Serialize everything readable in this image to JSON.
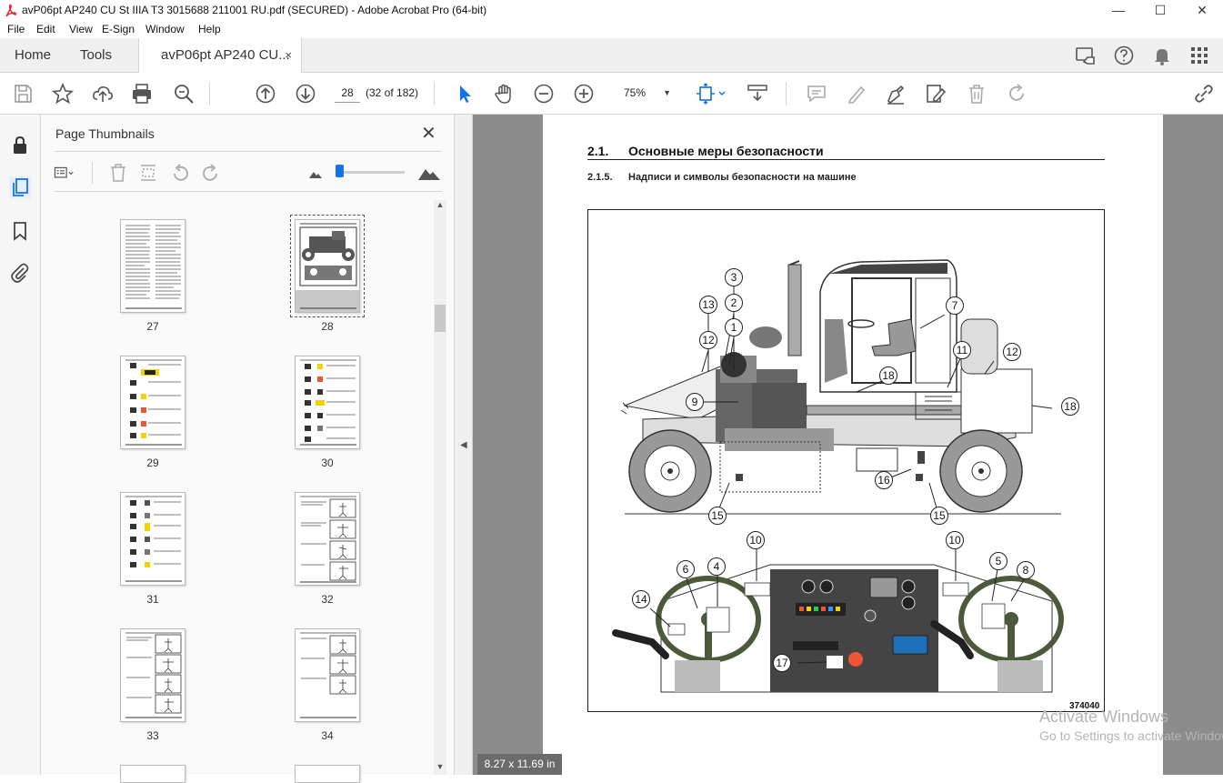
{
  "window": {
    "title": "avP06pt AP240 CU St IIIA T3 3015688 211001 RU.pdf (SECURED) - Adobe Acrobat Pro (64-bit)",
    "minimize": "—",
    "maximize": "☐",
    "close": "✕"
  },
  "menu": [
    "File",
    "Edit",
    "View",
    "E-Sign",
    "Window",
    "Help"
  ],
  "tabs": {
    "home": "Home",
    "tools": "Tools",
    "document": "avP06pt AP240 CU...",
    "close": "×"
  },
  "toolbar": {
    "page_input": "28",
    "page_count": "(32 of 182)",
    "zoom": "75%",
    "zoom_caret": "▼"
  },
  "thumbnails_panel": {
    "title": "Page Thumbnails",
    "close": "✕",
    "pages": [
      "27",
      "28",
      "29",
      "30",
      "31",
      "32",
      "33",
      "34"
    ],
    "selected": "28"
  },
  "document": {
    "section_number": "2.1.",
    "section_title": "Основные меры безопасности",
    "subsection_number": "2.1.5.",
    "subsection_title": "Надписи и символы безопасности на машине",
    "figure_number": "374040",
    "callouts": [
      "3",
      "2",
      "13",
      "1",
      "12",
      "7",
      "11",
      "12",
      "9",
      "18",
      "18",
      "16",
      "15",
      "15",
      "10",
      "10",
      "6",
      "4",
      "5",
      "8",
      "14",
      "17"
    ]
  },
  "status": {
    "page_size": "8.27 x 11.69 in"
  },
  "watermark": {
    "line1": "Activate Windows",
    "line2": "Go to Settings to activate Windows."
  },
  "colors": {
    "accent": "#1473e6",
    "doc_background": "#8c8c8c",
    "toolbar_icon": "#555555"
  }
}
